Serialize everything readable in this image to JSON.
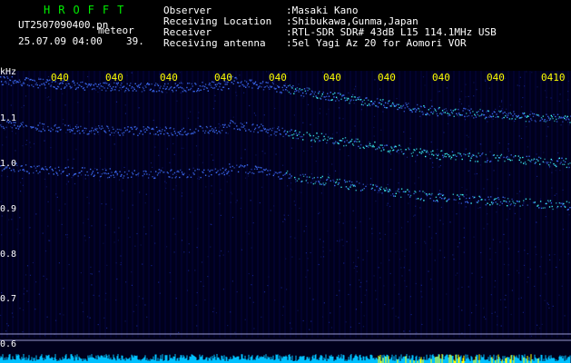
{
  "header": {
    "brand": "HROFFT",
    "filename": "UT2507090400.pn",
    "type_label": "meteor",
    "datetime": "25.07.09 04:00",
    "count": "39.",
    "observer_label": "Observer",
    "observer_value": ":Masaki Kano",
    "location_label": "Receiving Location",
    "location_value": ":Shibukawa,Gunma,Japan",
    "receiver_label": "Receiver",
    "receiver_value": ":RTL-SDR SDR# 43dB L15 114.1MHz USB",
    "antenna_label": "Receiving antenna",
    "antenna_value": ":5el Yagi Az 20 for Aomori VOR"
  },
  "spectrogram": {
    "unit_label": "kHz",
    "freq_ticks": [
      "1.1",
      "1.0",
      "0.9",
      "0.8",
      "0.7",
      "0.6"
    ],
    "time_ticks": [
      "040",
      "040",
      "040",
      "040",
      "040",
      "040",
      "040",
      "040",
      "040",
      "0410"
    ],
    "colors": {
      "background": "#00001c",
      "grid": "#0a0a5a",
      "signal": "#4070ff",
      "peak": "#40ffff",
      "baseline": "#00c0ff",
      "marker": "#ffff00"
    }
  }
}
